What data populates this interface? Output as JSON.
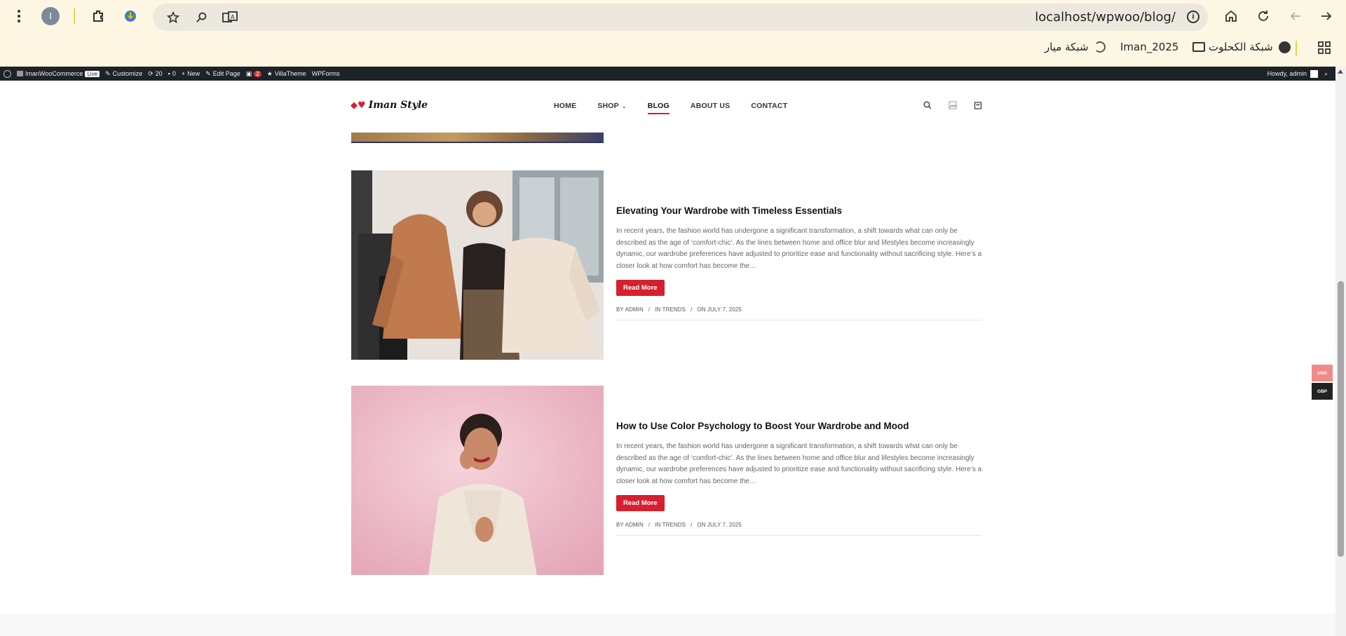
{
  "browser": {
    "profile_initial": "I",
    "url": "localhost/wpwoo/blog/",
    "bookmarks": [
      {
        "label": "شبكة الكحلوت",
        "icon": "globe-icon"
      },
      {
        "label": "Iman_2025",
        "icon": "folder-icon"
      },
      {
        "label": "شبكة ميار",
        "icon": "moon-icon"
      }
    ]
  },
  "adminbar": {
    "site_name": "ImanWooCommerce",
    "live": "Live",
    "customize": "Customize",
    "updates_count": "20",
    "comments_count": "0",
    "new": "New",
    "edit_page": "Edit Page",
    "notifications_count": "2",
    "villatheme": "VillaTheme",
    "wpforms": "WPForms",
    "howdy": "Howdy, admin"
  },
  "site": {
    "logo_text": "Iman Style",
    "nav": [
      {
        "label": "HOME"
      },
      {
        "label": "SHOP"
      },
      {
        "label": "BLOG"
      },
      {
        "label": "ABOUT US"
      },
      {
        "label": "CONTACT"
      }
    ]
  },
  "posts": [
    {
      "title": "Elevating Your Wardrobe with Timeless Essentials",
      "excerpt": "In recent years, the fashion world has undergone a significant transformation, a shift towards what can only be described as the age of ‘comfort-chic’. As the lines between home and office blur and lifestyles become increasingly dynamic, our wardrobe preferences have adjusted to prioritize ease and functionality without sacrificing style. Here’s a closer look at how comfort has become the…",
      "button": "Read More",
      "author": "BY ADMIN",
      "category": "IN TRENDS",
      "date": "ON JULY 7, 2025"
    },
    {
      "title": "How to Use Color Psychology to Boost Your Wardrobe and Mood",
      "excerpt": "In recent years, the fashion world has undergone a significant transformation, a shift towards what can only be described as the age of ‘comfort-chic’. As the lines between home and office blur and lifestyles become increasingly dynamic, our wardrobe preferences have adjusted to prioritize ease and functionality without sacrificing style. Here’s a closer look at how comfort has become the…",
      "button": "Read More",
      "author": "BY ADMIN",
      "category": "IN TRENDS",
      "date": "ON JULY 7, 2025"
    }
  ],
  "currency_switcher": {
    "usd": "USD",
    "gbp": "GBP"
  },
  "colors": {
    "accent": "#d6202f",
    "adminbar": "#1d2327",
    "chrome": "#fdf6e3"
  }
}
